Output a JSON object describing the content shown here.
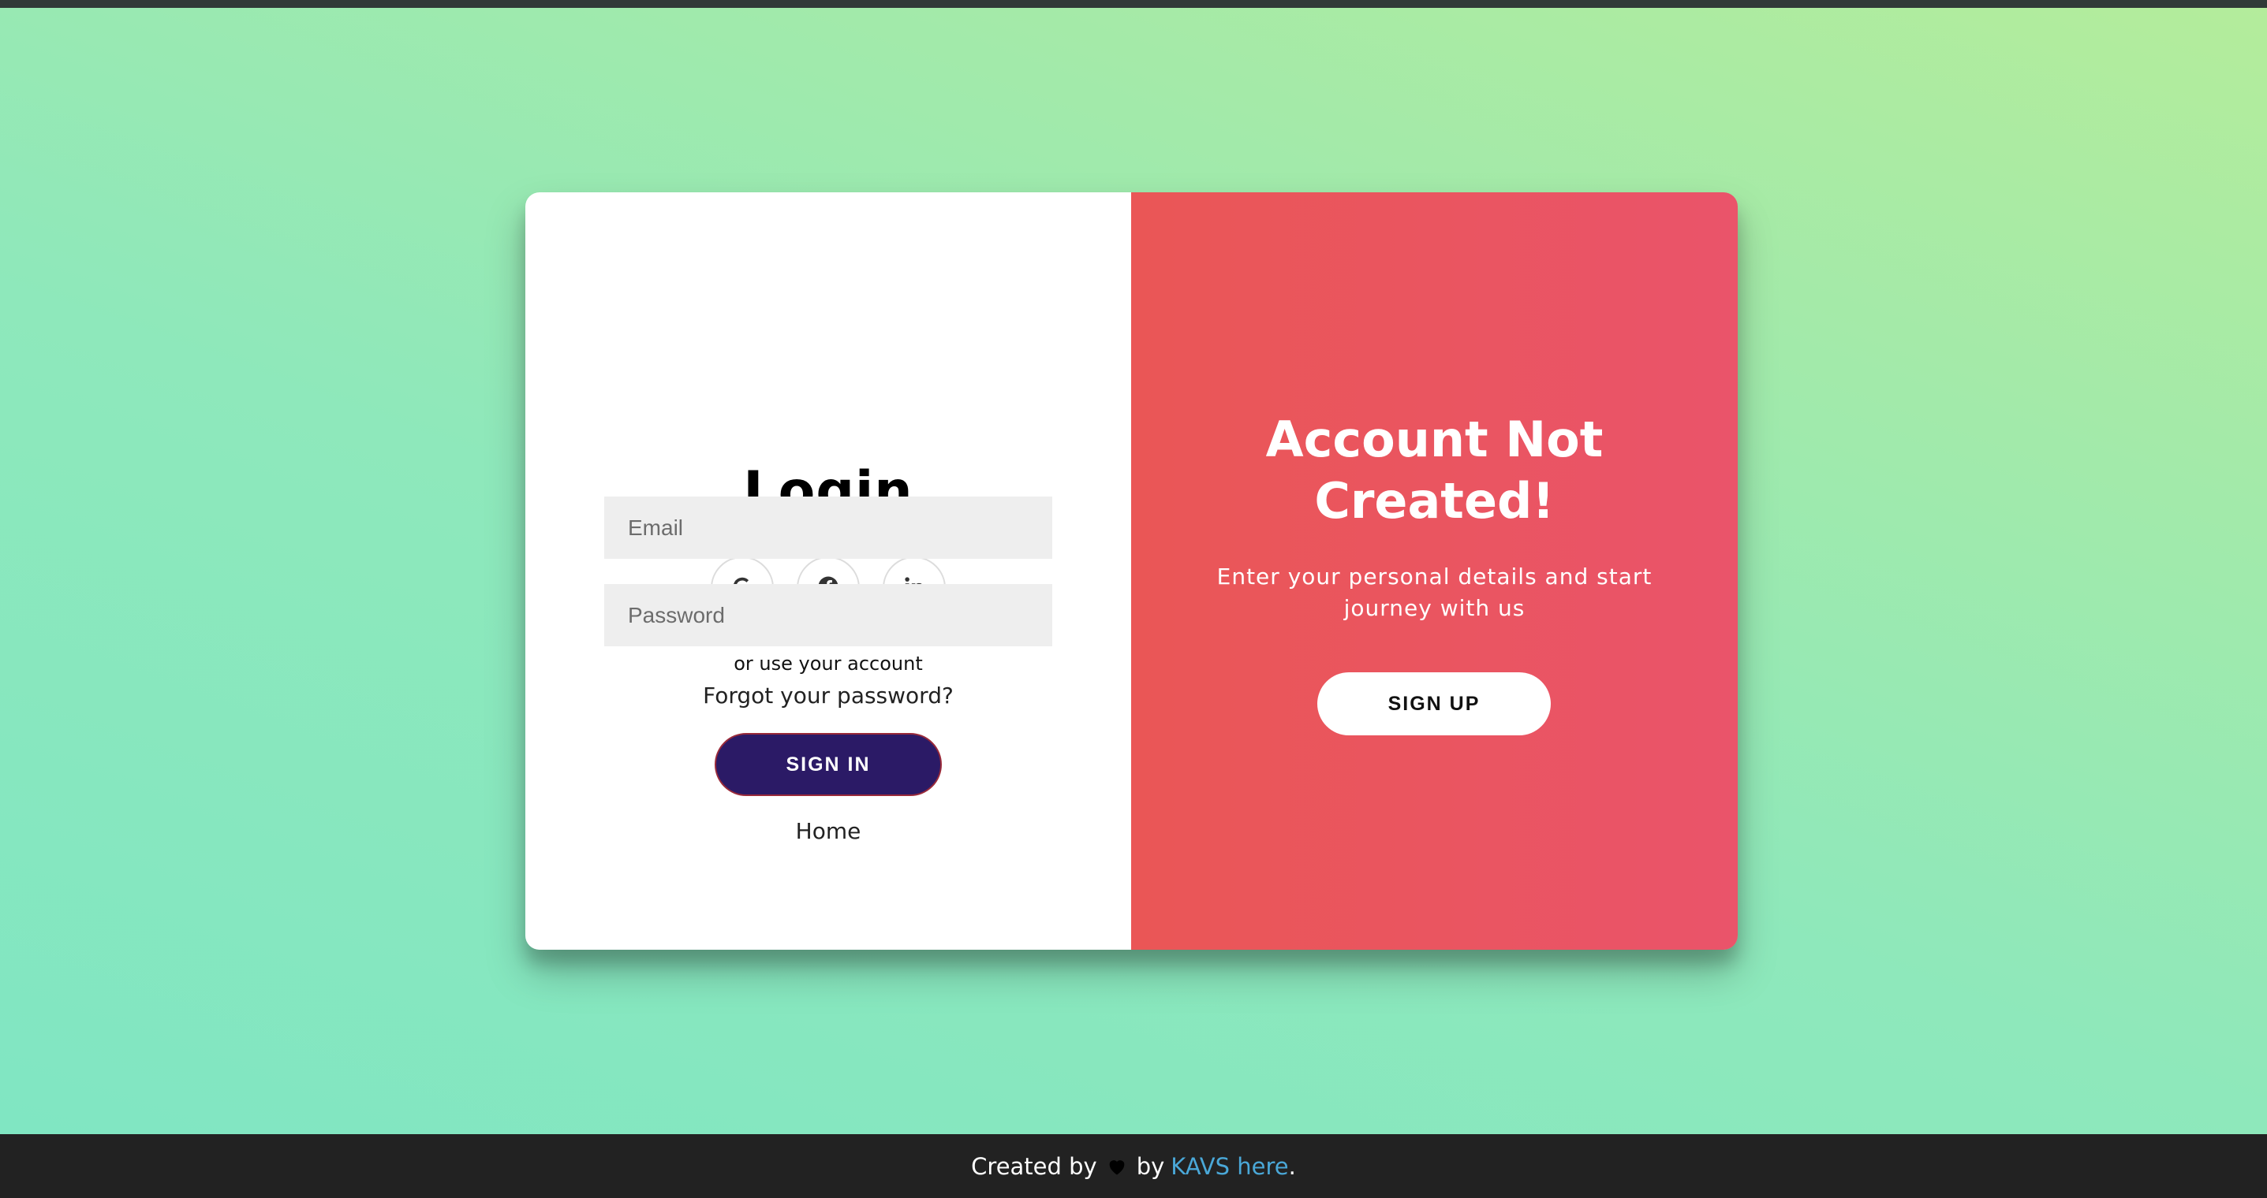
{
  "login": {
    "title": "Login",
    "or_text": "or use your account",
    "email_placeholder": "Email",
    "password_placeholder": "Password",
    "forgot": "Forgot your password?",
    "signin_label": "SIGN IN",
    "home_label": "Home",
    "socials": [
      {
        "icon": "google-icon",
        "glyph": "G"
      },
      {
        "icon": "facebook-icon",
        "glyph": "f"
      },
      {
        "icon": "linkedin-icon",
        "glyph": "in"
      }
    ]
  },
  "promo": {
    "title_line1": "Account Not",
    "title_line2": "Created!",
    "text_line1": "Enter your personal details and start",
    "text_line2": "journey with us",
    "signup_label": "SIGN UP"
  },
  "footer": {
    "created_by": "Created by",
    "by": "by",
    "link_text": "KAVS here",
    "period": "."
  },
  "colors": {
    "accent_primary": "#2b1a66",
    "accent_panel": "#ea5462",
    "link": "#4aa8d8"
  }
}
